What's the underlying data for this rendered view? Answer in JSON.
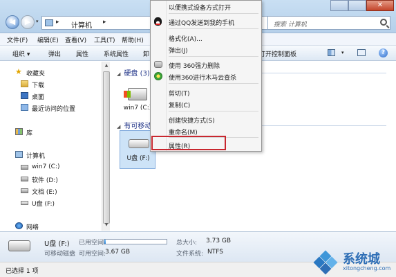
{
  "window": {
    "breadcrumb": [
      "计算机"
    ],
    "search_placeholder": "搜索 计算机",
    "close_glyph": "✕"
  },
  "menubar": [
    "文件(F)",
    "编辑(E)",
    "查看(V)",
    "工具(T)",
    "帮助(H)"
  ],
  "toolbar": {
    "items": [
      "组织 ▾",
      "弹出",
      "属性",
      "系统属性",
      "卸"
    ],
    "right_item": "打开控制面板",
    "view_dropdown": "▾",
    "help": "?"
  },
  "sidebar": {
    "favorites": "收藏夹",
    "downloads": "下载",
    "desktop": "桌面",
    "recent": "最近访问的位置",
    "libraries": "库",
    "computer": "计算机",
    "drives": [
      "win7 (C:)",
      "软件 (D:)",
      "文档 (E:)",
      "U盘 (F:)"
    ],
    "network": "网络"
  },
  "main": {
    "group_hdd": "硬盘 (3)",
    "group_removable": "有可移动",
    "tiles": [
      "win7 (C:)",
      "U盘 (F:)"
    ]
  },
  "details": {
    "name": "U盘 (F:)",
    "type": "可移动磁盘",
    "used_label": "已用空间:",
    "free_label": "可用空间:",
    "free_value": "3.67 GB",
    "total_label": "总大小:",
    "total_value": "3.73 GB",
    "fs_label": "文件系统:",
    "fs_value": "NTFS",
    "used_fraction": 0.02
  },
  "status": "已选择 1 项",
  "context_menu": {
    "items": [
      "以便携式设备方式打开",
      "通过QQ发送到我的手机",
      "格式化(A)...",
      "弹出(J)",
      "使用 360强力删除",
      "使用360进行木马云查杀",
      "剪切(T)",
      "复制(C)",
      "创建快捷方式(S)",
      "重命名(M)",
      "属性(R)"
    ]
  },
  "watermark": {
    "brand": "系统城",
    "url": "xitongcheng.com"
  },
  "colors": {
    "highlight_border": "#c8272f",
    "accent_blue": "#2f6fb6"
  }
}
